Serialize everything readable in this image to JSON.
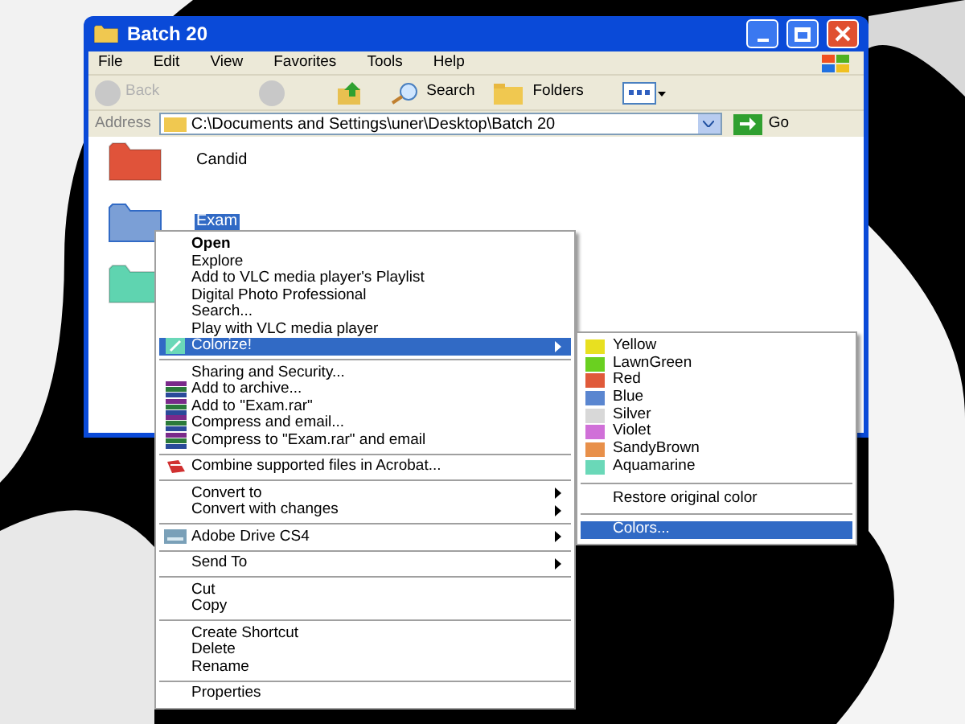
{
  "window": {
    "title": "Batch 20"
  },
  "menu_bar": [
    "File",
    "Edit",
    "View",
    "Favorites",
    "Tools",
    "Help"
  ],
  "toolbar": {
    "back": "Back",
    "search": "Search",
    "folders": "Folders"
  },
  "address_bar": {
    "label": "Address",
    "value": "C:\\Documents and Settings\\uner\\Desktop\\Batch 20",
    "go": "Go"
  },
  "folders": [
    {
      "name": "Candid",
      "color": "#e0533a",
      "selected": false
    },
    {
      "name": "Exam",
      "color": "#7b9fd6",
      "selected": true
    },
    {
      "color": "#5fd4b0",
      "selected": false
    }
  ],
  "context_menu": [
    {
      "kind": "text",
      "label": "Open",
      "bold": true,
      "submenu": false,
      "selected": false
    },
    {
      "kind": "text",
      "label": "Explore",
      "bold": false,
      "submenu": false,
      "selected": false
    },
    {
      "kind": "text",
      "label": "Add to VLC media player's Playlist",
      "bold": false,
      "submenu": false,
      "selected": false
    },
    {
      "kind": "text",
      "label": "Digital Photo Professional",
      "bold": false,
      "submenu": false,
      "selected": false
    },
    {
      "kind": "text",
      "label": "Search...",
      "bold": false,
      "submenu": false,
      "selected": false
    },
    {
      "kind": "text",
      "label": "Play with VLC media player",
      "bold": false,
      "submenu": false,
      "selected": false
    },
    {
      "kind": "colorize",
      "label": "Colorize!",
      "bold": false,
      "submenu": true,
      "selected": true
    },
    {
      "kind": "separator"
    },
    {
      "kind": "text",
      "label": "Sharing and Security...",
      "bold": false,
      "submenu": false,
      "selected": false
    },
    {
      "kind": "archive",
      "label": "Add to archive...",
      "bold": false,
      "submenu": false,
      "selected": false
    },
    {
      "kind": "archive",
      "label": "Add to \"Exam.rar\"",
      "bold": false,
      "submenu": false,
      "selected": false
    },
    {
      "kind": "archive",
      "label": "Compress and email...",
      "bold": false,
      "submenu": false,
      "selected": false
    },
    {
      "kind": "archive",
      "label": "Compress to \"Exam.rar\" and email",
      "bold": false,
      "submenu": false,
      "selected": false
    },
    {
      "kind": "separator"
    },
    {
      "kind": "acrobat",
      "label": "Combine supported files in Acrobat...",
      "bold": false,
      "submenu": false,
      "selected": false
    },
    {
      "kind": "separator"
    },
    {
      "kind": "text",
      "label": "Convert to",
      "bold": false,
      "submenu": true,
      "selected": false
    },
    {
      "kind": "text",
      "label": "Convert with changes",
      "bold": false,
      "submenu": true,
      "selected": false
    },
    {
      "kind": "separator"
    },
    {
      "kind": "drive",
      "label": "Adobe Drive CS4",
      "bold": false,
      "submenu": true,
      "selected": false
    },
    {
      "kind": "separator"
    },
    {
      "kind": "text",
      "label": "Send To",
      "bold": false,
      "submenu": true,
      "selected": false
    },
    {
      "kind": "separator"
    },
    {
      "kind": "text",
      "label": "Cut",
      "bold": false,
      "submenu": false,
      "selected": false
    },
    {
      "kind": "text",
      "label": "Copy",
      "bold": false,
      "submenu": false,
      "selected": false
    },
    {
      "kind": "separator"
    },
    {
      "kind": "text",
      "label": "Create Shortcut",
      "bold": false,
      "submenu": false,
      "selected": false
    },
    {
      "kind": "text",
      "label": "Delete",
      "bold": false,
      "submenu": false,
      "selected": false
    },
    {
      "kind": "text",
      "label": "Rename",
      "bold": false,
      "submenu": false,
      "selected": false
    },
    {
      "kind": "separator"
    },
    {
      "kind": "text",
      "label": "Properties",
      "bold": false,
      "submenu": false,
      "selected": false
    }
  ],
  "color_submenu": [
    {
      "kind": "swatch",
      "label": "Yellow",
      "color": "#e8e020",
      "selected": false
    },
    {
      "kind": "swatch",
      "label": "LawnGreen",
      "color": "#6ad020",
      "selected": false
    },
    {
      "kind": "swatch",
      "label": "Red",
      "color": "#e05a3a",
      "selected": false
    },
    {
      "kind": "swatch",
      "label": "Blue",
      "color": "#5a86d0",
      "selected": false
    },
    {
      "kind": "swatch",
      "label": "Silver",
      "color": "#d8d8d8",
      "selected": false
    },
    {
      "kind": "swatch",
      "label": "Violet",
      "color": "#d070d8",
      "selected": false
    },
    {
      "kind": "swatch",
      "label": "SandyBrown",
      "color": "#e8904a",
      "selected": false
    },
    {
      "kind": "swatch",
      "label": "Aquamarine",
      "color": "#6ad8b8",
      "selected": false
    },
    {
      "kind": "separator"
    },
    {
      "kind": "text",
      "label": "Restore original color",
      "selected": false
    },
    {
      "kind": "separator"
    },
    {
      "kind": "text",
      "label": "Colors...",
      "selected": true
    }
  ]
}
